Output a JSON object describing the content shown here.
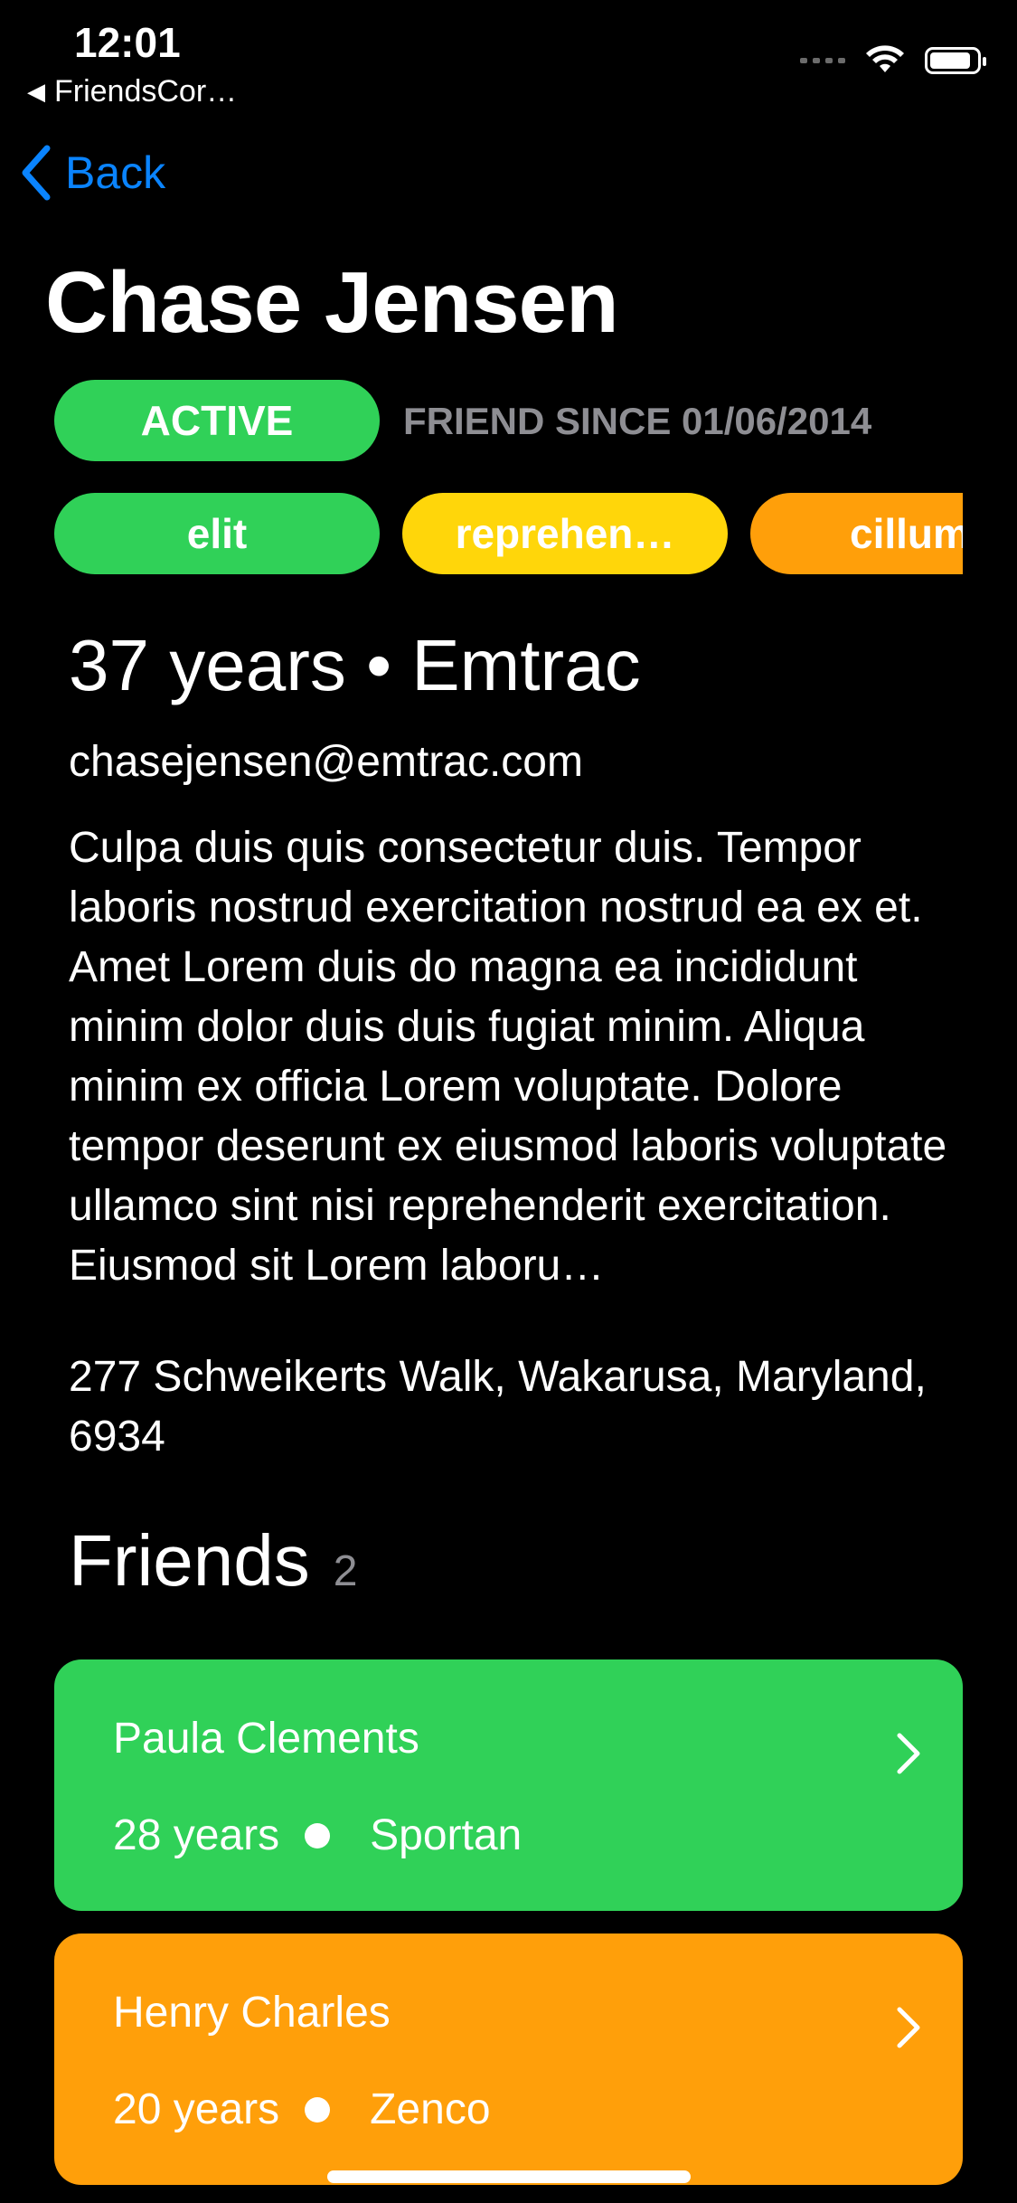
{
  "status_bar": {
    "time": "12:01",
    "back_app": "FriendsCor…"
  },
  "nav": {
    "back_label": "Back"
  },
  "profile": {
    "name": "Chase Jensen",
    "status": "ACTIVE",
    "friend_since": "FRIEND SINCE 01/06/2014",
    "tags": [
      "elit",
      "reprehen…",
      "cillum"
    ],
    "age_company": "37 years • Emtrac",
    "email": "chasejensen@emtrac.com",
    "about": "Culpa duis quis consectetur duis. Tempor laboris nostrud exercitation nostrud ea ex et. Amet Lorem duis do magna ea incididunt minim dolor duis duis fugiat minim. Aliqua minim ex officia Lorem voluptate. Dolore tempor deserunt ex eiusmod laboris voluptate ullamco sint nisi reprehenderit exercitation. Eiusmod sit Lorem laboru…",
    "address": "277 Schweikerts Walk, Wakarusa, Maryland, 6934"
  },
  "friends": {
    "title": "Friends",
    "count": "2",
    "items": [
      {
        "name": "Paula Clements",
        "age": "28 years",
        "company": "Sportan",
        "color": "#30d158"
      },
      {
        "name": "Henry Charles",
        "age": "20 years",
        "company": "Zenco",
        "color": "#ff9f0a"
      }
    ]
  },
  "colors": {
    "background": "#000000",
    "accent_blue": "#0a84ff",
    "green": "#30d158",
    "yellow": "#ffd60a",
    "orange": "#ff9f0a",
    "secondary_text": "#8e8e93"
  },
  "icons": [
    "back-app-triangle-icon",
    "signal-icon",
    "wifi-icon",
    "battery-icon",
    "chevron-left-icon",
    "chevron-right-icon"
  ]
}
